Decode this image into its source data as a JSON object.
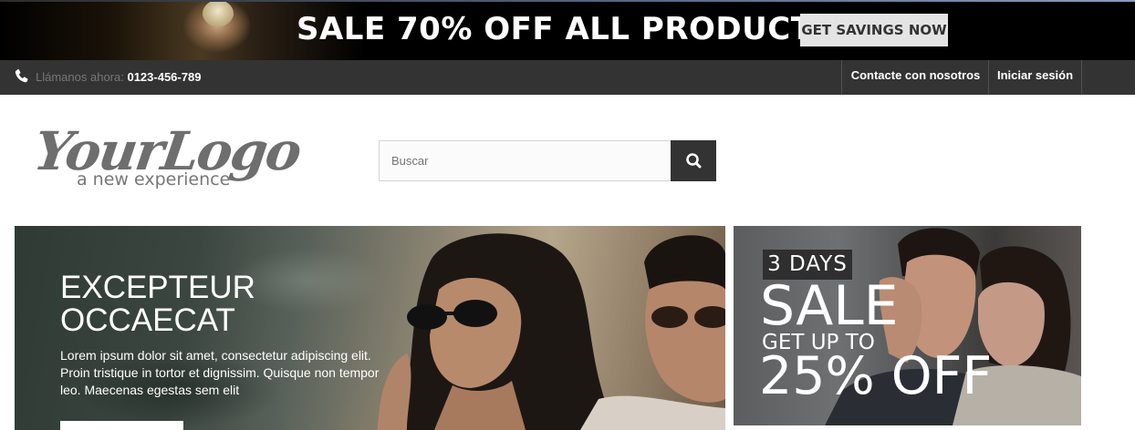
{
  "promo": {
    "title": "SALE 70% OFF ALL PRODUCTS",
    "button": "GET SAVINGS NOW"
  },
  "nav": {
    "call_label": "Llámanos ahora:",
    "phone": "0123-456-789",
    "contact": "Contacte con nosotros",
    "login": "Iniciar sesión"
  },
  "logo": {
    "text": "YourLogo",
    "tagline": "a new experience"
  },
  "search": {
    "placeholder": "Buscar"
  },
  "slider": {
    "title_line1": "EXCEPTEUR",
    "title_line2": "OCCAECAT",
    "text": "Lorem ipsum dolor sit amet, consectetur adipiscing elit. Proin tristique in tortor et dignissim. Quisque non tempor leo. Maecenas egestas sem elit"
  },
  "side_banner": {
    "days": "3 DAYS",
    "sale": "SALE",
    "get_up_to": "GET UP TO",
    "percent_off": "25% OFF"
  },
  "colors": {
    "dark": "#333333",
    "promo_bg": "#000000",
    "button_light": "#e4e4e4"
  }
}
